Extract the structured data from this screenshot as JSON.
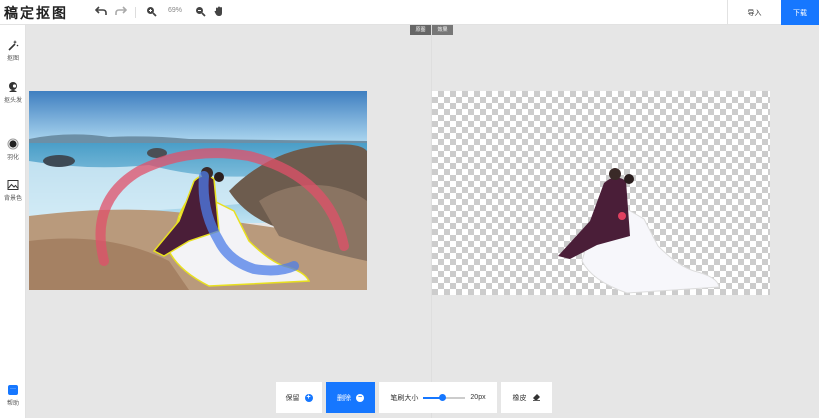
{
  "app": {
    "logo": "稿定抠图"
  },
  "toolbar": {
    "zoom_level": "69%",
    "import_label": "导入",
    "download_label": "下载"
  },
  "sidebar": {
    "items": [
      {
        "label": "抠图",
        "icon": "magic-wand-icon"
      },
      {
        "label": "抠头发",
        "icon": "hair-icon"
      },
      {
        "label": "羽化",
        "icon": "feather-circle-icon"
      },
      {
        "label": "背景色",
        "icon": "background-color-icon"
      }
    ],
    "help_label": "帮助"
  },
  "view_toggle": {
    "original_label": "原图",
    "result_label": "效果"
  },
  "brush_bar": {
    "keep_label": "保留",
    "erase_label": "删除",
    "size_label": "笔刷大小",
    "size_value": "20px",
    "size_fraction": 0.45,
    "eraser_label": "橡皮"
  },
  "colors": {
    "accent": "#1677ff",
    "keep_stroke": "#e0506a",
    "erase_stroke": "#4d7de8",
    "outline": "#e8e020"
  }
}
